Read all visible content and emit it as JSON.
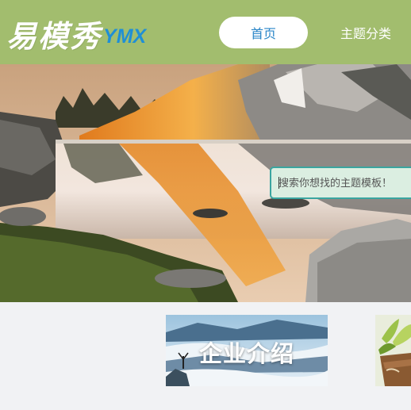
{
  "header": {
    "logo_cn": "易模秀",
    "logo_en": "YMX",
    "nav": [
      {
        "label": "首页",
        "active": true
      },
      {
        "label": "主题分类",
        "active": false
      }
    ]
  },
  "search": {
    "placeholder": "搜索你想找的主题模板！"
  },
  "cards": [
    {
      "title": "企业介绍"
    }
  ],
  "colors": {
    "header_bg": "#a2bd6e",
    "accent_blue": "#1f8fd6",
    "search_border": "#3aa5a0",
    "page_bg": "#f1f2f4"
  }
}
